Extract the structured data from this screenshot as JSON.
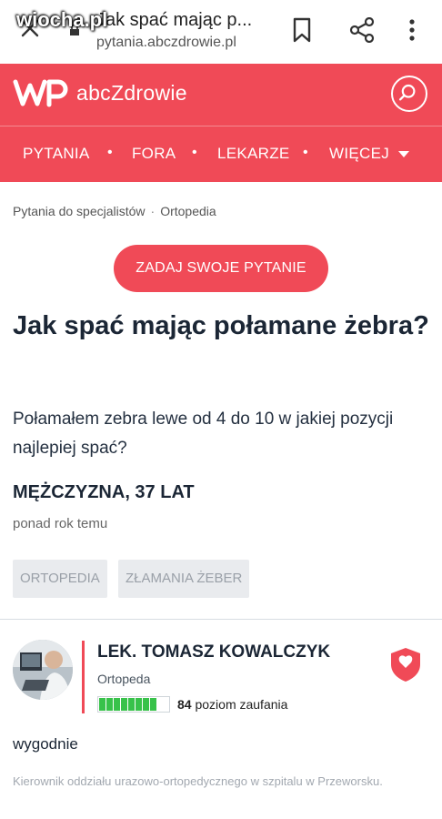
{
  "browser": {
    "tab_title": "Jak spać mając p...",
    "url": "pytania.abczdrowie.pl",
    "watermark": "wiocha.pl"
  },
  "header": {
    "logo_text": "abcZdrowie",
    "nav": [
      {
        "label": "PYTANIA"
      },
      {
        "label": "FORA"
      },
      {
        "label": "LEKARZE"
      },
      {
        "label": "WIĘCEJ"
      }
    ]
  },
  "breadcrumb": {
    "items": [
      "Pytania do specjalistów",
      "Ortopedia"
    ],
    "separator": "·"
  },
  "ask_button": "ZADAJ SWOJE PYTANIE",
  "question": {
    "title": "Jak spać mając połamane żebra?",
    "body": "Połamałem zebra lewe od 4 do 10 w jakiej pozycji najlepiej spać?",
    "author": "MĘŻCZYZNA, 37 LAT",
    "time": "ponad rok temu",
    "tags": [
      "ORTOPEDIA",
      "ZŁAMANIA ŻEBER"
    ]
  },
  "answer": {
    "doctor_name": "LEK. TOMASZ KOWALCZYK",
    "specialty": "Ortopeda",
    "trust_value": "84",
    "trust_label": "poziom zaufania",
    "trust_level": 0.84,
    "text": "wygodnie",
    "bio": "Kierownik oddziału urazowo-ortopedycznego w szpitalu w Przeworsku."
  },
  "colors": {
    "brand": "#f04a57",
    "trust_green": "#38c24a"
  },
  "icons": [
    "close-icon",
    "lock-icon",
    "bookmark-icon",
    "share-icon",
    "more-vert-icon",
    "search-icon",
    "chevron-down-icon",
    "shield-icon"
  ]
}
